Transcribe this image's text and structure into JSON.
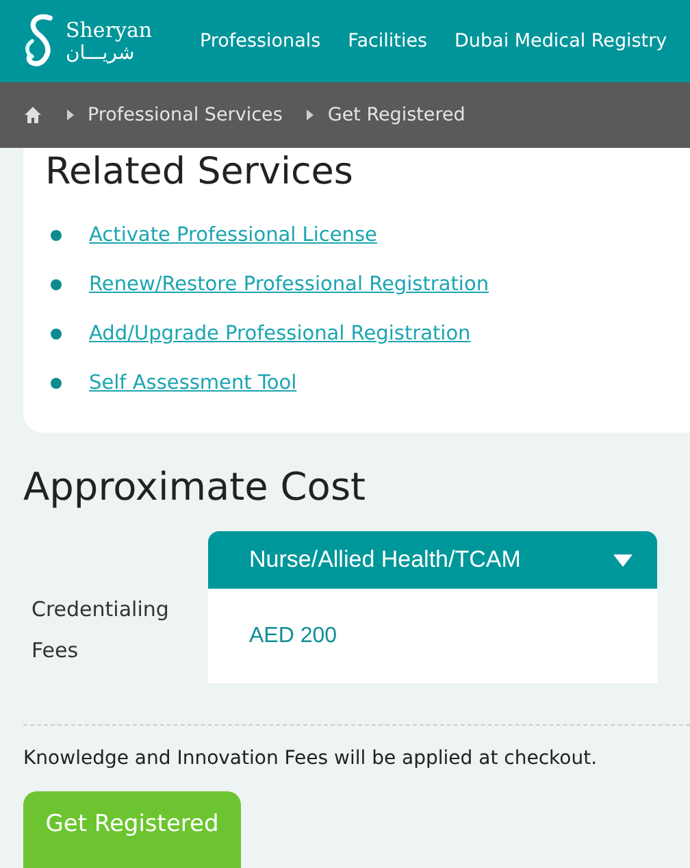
{
  "header": {
    "logo": {
      "latin": "Sheryan",
      "arabic": "شريـــان"
    },
    "nav": [
      "Professionals",
      "Facilities",
      "Dubai Medical Registry"
    ]
  },
  "breadcrumb": [
    "Professional Services",
    "Get Registered"
  ],
  "related_services": {
    "title": "Related Services",
    "links": [
      "Activate Professional License",
      "Renew/Restore Professional Registration",
      "Add/Upgrade Professional Registration",
      "Self Assessment Tool"
    ]
  },
  "approximate_cost": {
    "title": "Approximate Cost",
    "label": "Credentialing Fees",
    "dropdown": "Nurse/Allied Health/TCAM",
    "amount": "AED 200",
    "note": "Knowledge and Innovation Fees will be applied at checkout.",
    "button": "Get Registered"
  }
}
